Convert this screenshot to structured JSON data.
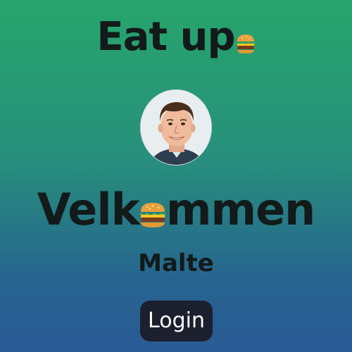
{
  "header": {
    "title": "Eat up",
    "title_emoji_icon": "hamburger-icon"
  },
  "profile": {
    "avatar": "profile-photo",
    "welcome_parts": [
      "Velk",
      "mmen"
    ],
    "welcome_emoji_icon": "hamburger-icon",
    "username": "Malte"
  },
  "actions": {
    "login_label": "Login"
  },
  "colors": {
    "gradient_top": "#27a56c",
    "gradient_bottom": "#2a5a96",
    "button_bg": "#1c1f2e",
    "text": "#121a1a"
  }
}
